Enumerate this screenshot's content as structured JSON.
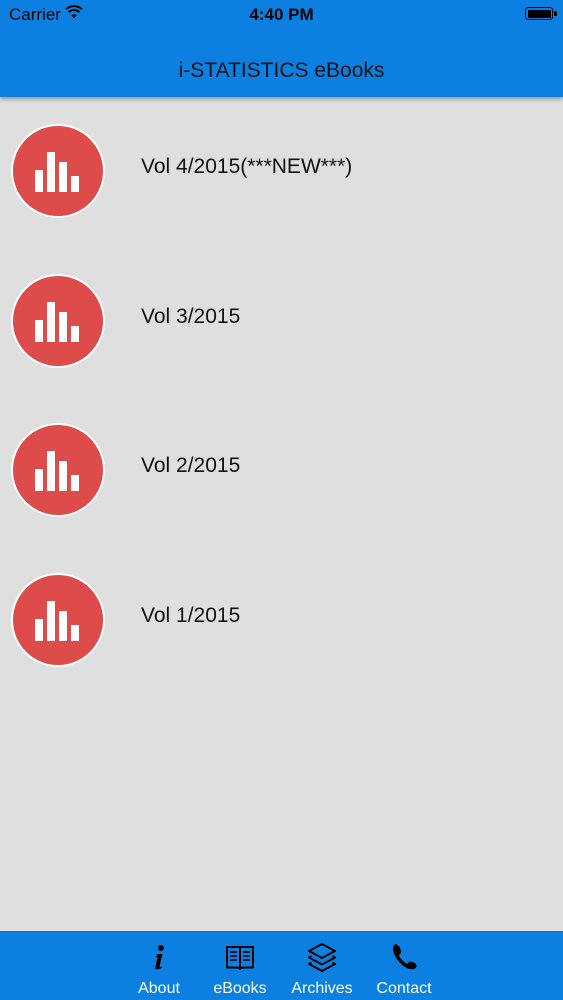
{
  "status_bar": {
    "carrier": "Carrier",
    "time": "4:40 PM"
  },
  "nav": {
    "title": "i-STATISTICS eBooks"
  },
  "colors": {
    "bar_blue": "#0b80e0",
    "icon_red": "#dd4c4a",
    "background": "#dfdfdf"
  },
  "list": {
    "items": [
      {
        "label": "Vol 4/2015(***NEW***)",
        "icon": "bar-chart-icon"
      },
      {
        "label": "Vol 3/2015",
        "icon": "bar-chart-icon"
      },
      {
        "label": "Vol 2/2015",
        "icon": "bar-chart-icon"
      },
      {
        "label": "Vol 1/2015",
        "icon": "bar-chart-icon"
      }
    ]
  },
  "tabbar": {
    "tabs": [
      {
        "label": "About",
        "icon": "info-icon"
      },
      {
        "label": "eBooks",
        "icon": "book-icon"
      },
      {
        "label": "Archives",
        "icon": "layers-icon"
      },
      {
        "label": "Contact",
        "icon": "phone-icon"
      }
    ]
  }
}
